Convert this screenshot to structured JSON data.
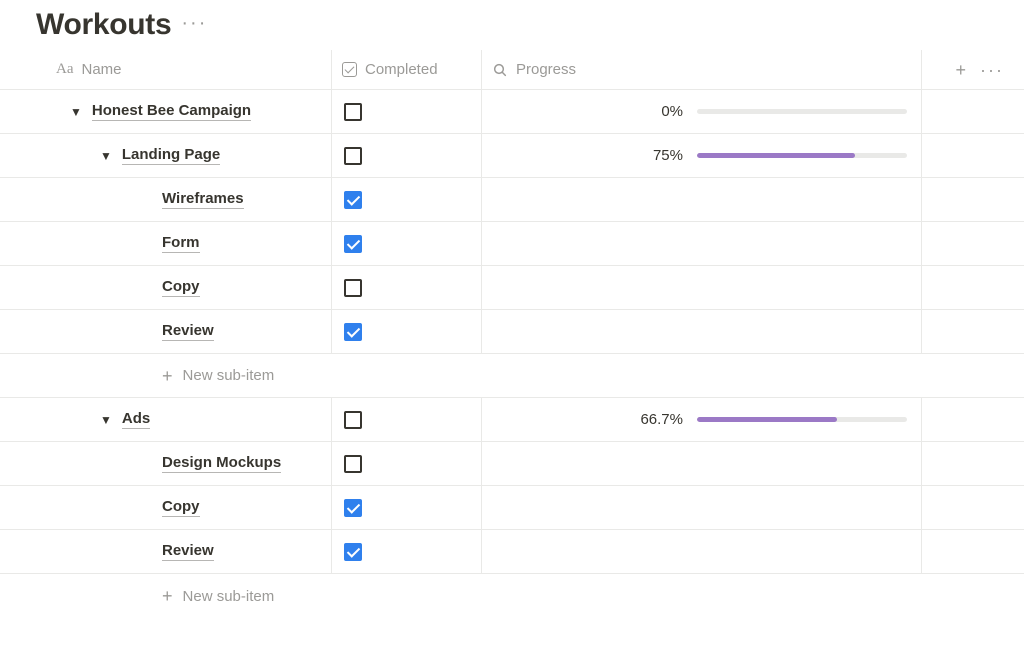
{
  "title": "Workouts",
  "columns": {
    "name": "Name",
    "completed": "Completed",
    "progress": "Progress"
  },
  "newSubItemLabel": "New sub-item",
  "rows": [
    {
      "id": 0,
      "indent": 0,
      "toggle": true,
      "name": "Honest Bee Campaign",
      "completed": false,
      "progress": {
        "text": "0%",
        "pct": 0
      }
    },
    {
      "id": 1,
      "indent": 1,
      "toggle": true,
      "name": "Landing Page",
      "completed": false,
      "progress": {
        "text": "75%",
        "pct": 75
      }
    },
    {
      "id": 2,
      "indent": 2,
      "toggle": false,
      "name": "Wireframes",
      "completed": true,
      "progress": null
    },
    {
      "id": 3,
      "indent": 2,
      "toggle": false,
      "name": "Form",
      "completed": true,
      "progress": null
    },
    {
      "id": 4,
      "indent": 2,
      "toggle": false,
      "name": "Copy",
      "completed": false,
      "progress": null
    },
    {
      "id": 5,
      "indent": 2,
      "toggle": false,
      "name": "Review",
      "completed": true,
      "progress": null
    },
    {
      "id": "n1",
      "newSubItem": true
    },
    {
      "id": 6,
      "indent": 1,
      "toggle": true,
      "name": "Ads",
      "completed": false,
      "progress": {
        "text": "66.7%",
        "pct": 66.7
      }
    },
    {
      "id": 7,
      "indent": 2,
      "toggle": false,
      "name": "Design Mockups",
      "completed": false,
      "progress": null
    },
    {
      "id": 8,
      "indent": 2,
      "toggle": false,
      "name": "Copy",
      "completed": true,
      "progress": null
    },
    {
      "id": 9,
      "indent": 2,
      "toggle": false,
      "name": "Review",
      "completed": true,
      "progress": null
    },
    {
      "id": "n2",
      "newSubItem": true,
      "last": true
    }
  ]
}
